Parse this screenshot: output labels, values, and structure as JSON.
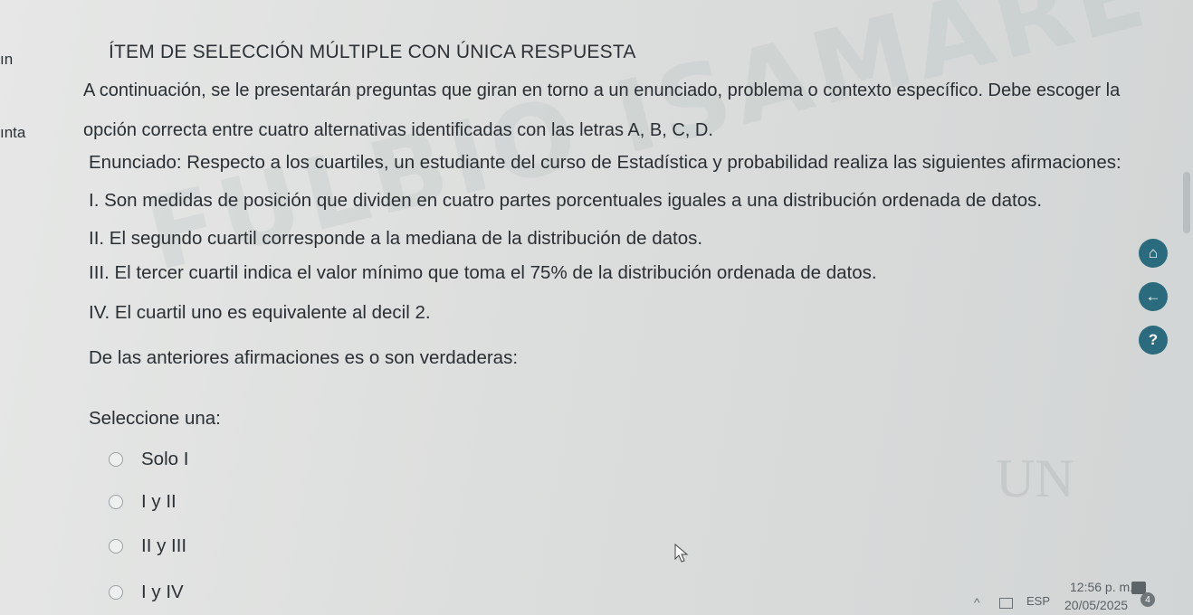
{
  "sidebar": {
    "item1": "ın",
    "item2": "ınta"
  },
  "question": {
    "heading": "ÍTEM DE SELECCIÓN MÚLTIPLE CON ÚNICA RESPUESTA",
    "intro_line1": "A continuación, se le presentarán preguntas que giran en torno a un enunciado, problema o contexto específico. Debe escoger la",
    "intro_line2": "opción correcta entre cuatro alternativas identificadas con las letras A, B, C, D.",
    "stem": "Enunciado: Respecto a los cuartiles, un estudiante del curso de Estadística y probabilidad realiza las siguientes afirmaciones:",
    "statements": [
      "I. Son medidas de posición que dividen en cuatro partes porcentuales iguales a una distribución ordenada de datos.",
      "II. El segundo cuartil corresponde a la mediana de la distribución de datos.",
      "III. El tercer cuartil indica el valor mínimo que toma el 75% de la distribución ordenada de datos.",
      "IV. El cuartil uno es equivalente al decil 2."
    ],
    "prompt": "De las anteriores afirmaciones es o son verdaderas:",
    "select_label": "Seleccione una:",
    "options": [
      "Solo I",
      "I y II",
      "II y III",
      "I y IV"
    ]
  },
  "watermark": {
    "text": "FULBIO ISAMARE CHIRIPUA"
  },
  "floating_buttons": {
    "home_icon": "⌂",
    "back_icon": "←",
    "help_icon": "?"
  },
  "taskbar": {
    "language": "ESP",
    "time": "12:56 p. m.",
    "date": "20/05/2025",
    "notification_count": "4"
  }
}
